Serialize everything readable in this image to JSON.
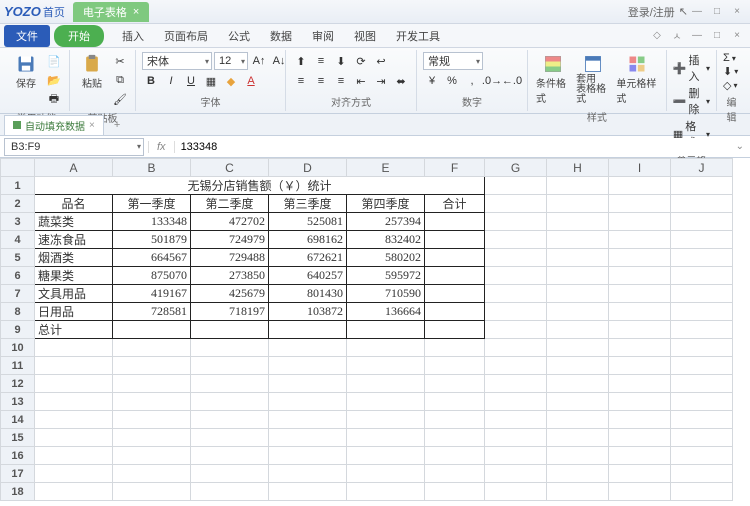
{
  "app": {
    "logo": "YOZO",
    "home": "首页",
    "doc_tab": "电子表格",
    "login": "登录/注册"
  },
  "menu": {
    "file": "文件",
    "start": "开始",
    "items": [
      "插入",
      "页面布局",
      "公式",
      "数据",
      "审阅",
      "视图",
      "开发工具"
    ]
  },
  "ribbon": {
    "save": "保存",
    "common": "常用功能",
    "paste": "粘贴",
    "clipboard": "剪贴板",
    "font_name": "宋体",
    "font_size": "12",
    "font_group": "字体",
    "align_group": "对齐方式",
    "num_format": "常规",
    "num_group": "数字",
    "cond_fmt": "条件格式",
    "table_fmt": "套用\n表格格式",
    "cell_style": "单元格样式",
    "style_group": "样式",
    "insert": "插入",
    "delete": "删除",
    "format": "格式",
    "cell_group": "单元格",
    "edit_group": "编辑"
  },
  "sheet": {
    "tab": "自动填充数据"
  },
  "formula": {
    "ref": "B3:F9",
    "value": "133348"
  },
  "table": {
    "title": "无锡分店销售额（￥）统计",
    "headers": [
      "品名",
      "第一季度",
      "第二季度",
      "第三季度",
      "第四季度",
      "合计"
    ],
    "rows": [
      {
        "name": "蔬菜类",
        "q": [
          133348,
          472702,
          525081,
          257394
        ]
      },
      {
        "name": "速冻食品",
        "q": [
          501879,
          724979,
          698162,
          832402
        ]
      },
      {
        "name": "烟酒类",
        "q": [
          664567,
          729488,
          672621,
          580202
        ]
      },
      {
        "name": "糖果类",
        "q": [
          875070,
          273850,
          640257,
          595972
        ]
      },
      {
        "name": "文具用品",
        "q": [
          419167,
          425679,
          801430,
          710590
        ]
      },
      {
        "name": "日用品",
        "q": [
          728581,
          718197,
          103872,
          136664
        ]
      }
    ],
    "total_label": "总计"
  },
  "cols": [
    "A",
    "B",
    "C",
    "D",
    "E",
    "F",
    "G",
    "H",
    "I",
    "J"
  ],
  "chart_data": {
    "type": "table",
    "title": "无锡分店销售额（￥）统计",
    "categories": [
      "第一季度",
      "第二季度",
      "第三季度",
      "第四季度"
    ],
    "series": [
      {
        "name": "蔬菜类",
        "values": [
          133348,
          472702,
          525081,
          257394
        ]
      },
      {
        "name": "速冻食品",
        "values": [
          501879,
          724979,
          698162,
          832402
        ]
      },
      {
        "name": "烟酒类",
        "values": [
          664567,
          729488,
          672621,
          580202
        ]
      },
      {
        "name": "糖果类",
        "values": [
          875070,
          273850,
          640257,
          595972
        ]
      },
      {
        "name": "文具用品",
        "values": [
          419167,
          425679,
          801430,
          710590
        ]
      },
      {
        "name": "日用品",
        "values": [
          728581,
          718197,
          103872,
          136664
        ]
      }
    ]
  }
}
